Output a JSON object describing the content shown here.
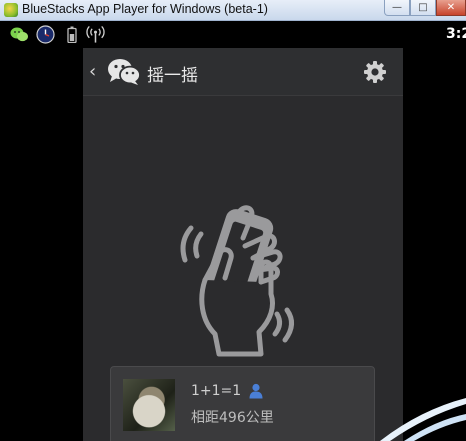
{
  "window": {
    "title": "BlueStacks App Player for Windows (beta-1)",
    "controls": {
      "minimize": "—",
      "maximize": "□",
      "close": "✕"
    }
  },
  "statusbar": {
    "icons": [
      "wechat-icon",
      "clock-app-icon",
      "battery-icon",
      "wifi-antenna-icon"
    ],
    "time": "3:2"
  },
  "app": {
    "back_glyph": "‹",
    "title": "摇一摇",
    "settings_icon": "gear-icon"
  },
  "shake": {
    "illustration": "hand-shaking-phone-icon"
  },
  "result": {
    "name": "1+1=1",
    "distance": "相距496公里",
    "gender_icon": "male-user-icon"
  },
  "colors": {
    "screen_bg": "#2b2b2d",
    "card_bg": "#3a3a3c",
    "gender_blue": "#4a7fd6"
  }
}
